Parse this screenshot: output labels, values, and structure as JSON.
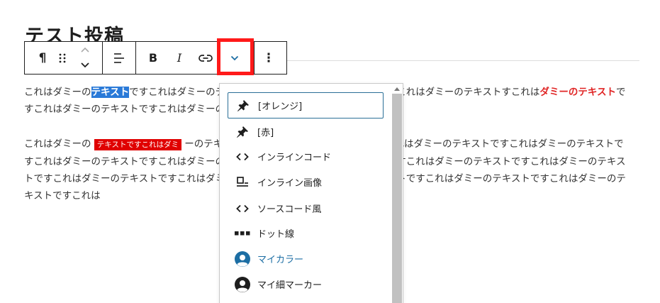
{
  "post": {
    "title": "テスト投稿",
    "paragraph1": {
      "a": "これはダミーの",
      "selected": "テキスト",
      "b": "ですこれはダミーの",
      "hidden_a": "テキストですこれはダミーのテキストですこれはダミーのテキスト",
      "c": "すこれは",
      "red": "ダミーのテキスト",
      "d": "ですこれはダミーのテキストですこれはダミーのテキストですこれは"
    },
    "paragraph2": {
      "a": "これはダミーの",
      "red_bg": "テキストですこれはダミ",
      "b": "ーのテキストですこれはダミーのテキストですこれはダミーのテキストですこれはダミーのテキストですこれはダミーのテキストですこれはダミーのテキストですこれはダミーのテキストですこれはダミーのテキストですこれはダミーのテキストですこれはダミーのテキストですこれはダミーのテキストですこれはダミーのテキストですこれはダミーのテキストですこれはダミーのテキストですこれは"
    }
  },
  "toolbar": {
    "paragraph_icon": "¶",
    "bold_label": "B",
    "italic_label": "I",
    "more_label": "⋮"
  },
  "dropdown": {
    "items": [
      {
        "label": "[オレンジ]",
        "icon": "pin-icon"
      },
      {
        "label": "[赤]",
        "icon": "pin-icon"
      },
      {
        "label": "インラインコード",
        "icon": "code-icon"
      },
      {
        "label": "インライン画像",
        "icon": "inline-image-icon"
      },
      {
        "label": "ソースコード風",
        "icon": "code-icon"
      },
      {
        "label": "ドット線",
        "icon": "dotted-line-icon"
      },
      {
        "label": "マイカラー",
        "icon": "avatar-icon"
      },
      {
        "label": "マイ細マーカー",
        "icon": "avatar-icon"
      }
    ]
  },
  "colors": {
    "accent": "#1c6ea4",
    "highlight_box": "#ff1a1a",
    "selection": "#2a7ad8",
    "red_text": "#e02525"
  }
}
